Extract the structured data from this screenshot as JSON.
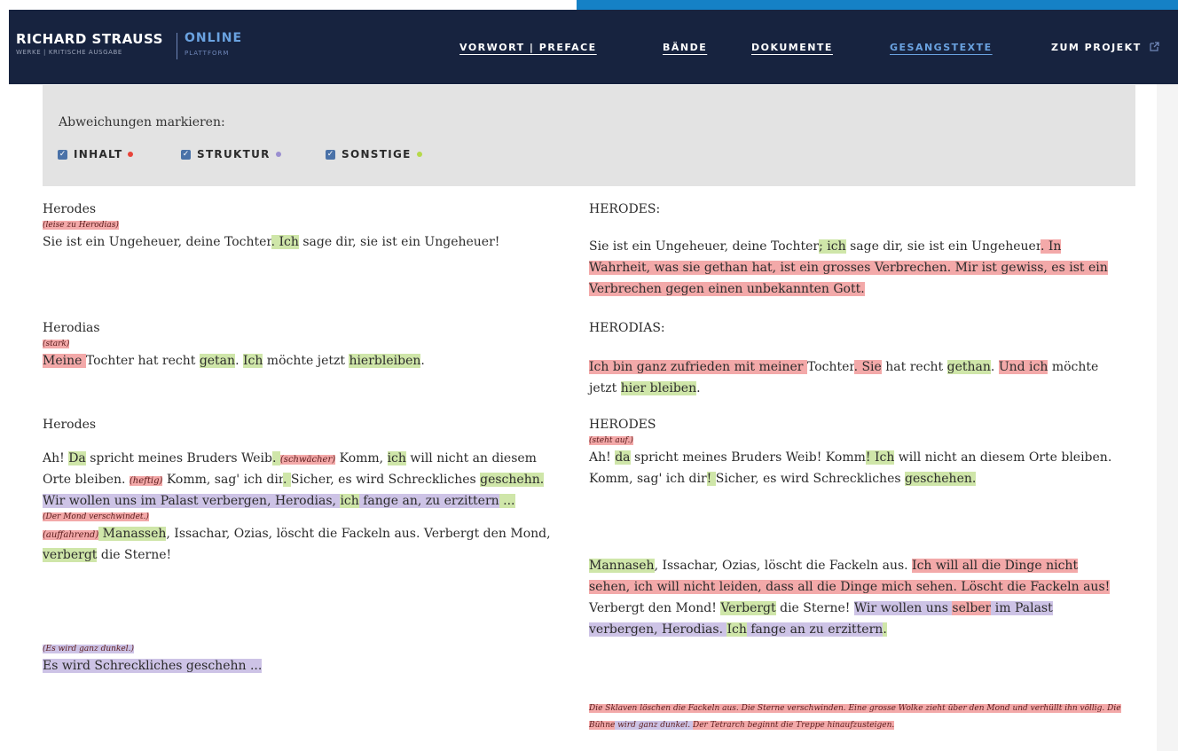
{
  "header": {
    "brand": {
      "name": "RICHARD STRAUSS",
      "sub": "WERKE | KRITISCHE AUSGABE",
      "online": "ONLINE",
      "platform": "PLATTFORM"
    },
    "menu": [
      {
        "label": "VORWORT | PREFACE"
      },
      {
        "label": "BÄNDE"
      },
      {
        "label": "DOKUMENTE"
      },
      {
        "label": "GESANGSTEXTE"
      },
      {
        "label": "ZUM PROJEKT"
      }
    ],
    "external_icon": "external-link-icon"
  },
  "filter": {
    "title": "Abweichungen markieren:",
    "options": [
      {
        "label": "INHALT",
        "checked": true,
        "color": "#e8443a"
      },
      {
        "label": "STRUKTUR",
        "checked": true,
        "color": "#9b8fd0"
      },
      {
        "label": "SONSTIGE",
        "checked": true,
        "color": "#b6d94a"
      }
    ]
  },
  "colors": {
    "content": "#f3a9a9",
    "structure": "#cdc3e6",
    "other": "#cfe6a9",
    "nav": "#17233f",
    "accent": "#1581c6"
  },
  "left": {
    "b1": {
      "speaker": "Herodes",
      "dir": "(leise zu Herodias)",
      "t1": "Sie ist ein Ungeheuer, deine Tochter",
      "t2": ". ",
      "t3": "Ich",
      "t4": " sage dir, sie ist ein Ungeheuer!"
    },
    "b2": {
      "speaker": "Herodias",
      "dir": "(stark)",
      "t1": "Meine ",
      "t2": "Tochter hat recht ",
      "t3": "getan",
      "t4": ". ",
      "t5": "Ich",
      "t6": " möchte jetzt ",
      "t7": "hierbleiben",
      "t8": "."
    },
    "b3": {
      "speaker": "Herodes",
      "t1": "Ah! ",
      "t2": "Da",
      "t3": " spricht meines Bruders Weib",
      "t4": ". ",
      "t5": "(schwächer)",
      "t6": " Komm, ",
      "t7": "ich",
      "t8": " will nicht an diesem Orte bleiben. ",
      "t9": "(heftig)",
      "t10": " Komm, sag' ich dir",
      "t11": ". ",
      "t12": "Sicher, es wird Schreckliches ",
      "t13": "geschehn",
      "t14": ". ",
      "t15": "Wir wollen uns im Palast verbergen, Herodias, ",
      "t16": "ich",
      "t17": " fange an, zu erzittern",
      "t18": " ...",
      "dir1": "(Der Mond verschwindet.)",
      "t19": "(auffahrend)",
      "t20": " Manasseh",
      "t21": ", Issachar, Ozias, löscht die Fackeln aus. Verbergt den Mond, ",
      "t22": "verbergt",
      "t23": " die Sterne!"
    },
    "b4": {
      "dir": "(Es wird ganz dunkel.)",
      "t1": "Es wird Schreckliches geschehn ..."
    }
  },
  "right": {
    "b1": {
      "speaker": "HERODES:",
      "t1": "Sie ist ein Ungeheuer, deine Tochter",
      "t2": "; ",
      "t3": "ich",
      "t4": " sage dir, sie ist ein Ungeheuer",
      "t5": ". In Wahrheit, was sie gethan hat, ist ein grosses Verbrechen. Mir ist gewiss, es ist ein Verbrechen gegen einen unbekannten Gott."
    },
    "b2": {
      "speaker": "HERODIAS:",
      "t1": "Ich bin ganz zufrieden mit meiner ",
      "t2": "Tochter",
      "t3": ". Sie",
      "t4": " hat recht ",
      "t5": "gethan",
      "t6": ". ",
      "t7": "Und ich",
      "t8": " möchte jetzt ",
      "t9": "hier bleiben",
      "t10": "."
    },
    "b3": {
      "speaker": "HERODES",
      "dir": "(steht auf.)",
      "t1": "Ah! ",
      "t2": "da",
      "t3": " spricht meines Bruders Weib! Komm",
      "t4": "! ",
      "t5": "Ich",
      "t6": " will nicht an diesem Orte bleiben. Komm, sag' ich dir",
      "t7": "! ",
      "t8": "Sicher, es wird Schreckliches ",
      "t9": "geschehen",
      "t10": "."
    },
    "b4": {
      "t1": "Mannaseh",
      "t2": ", Issachar, Ozias, löscht die Fackeln aus. ",
      "t3": "Ich will all die Dinge nicht sehen, ich will nicht leiden, dass all die Dinge mich sehen. Löscht die Fackeln aus!",
      "t4": " Verbergt den Mond! ",
      "t5": "Verbergt",
      "t6": " die Sterne! ",
      "t7": "Wir wollen uns ",
      "t8": "selber",
      "t9": " im Palast verbergen, Herodias. ",
      "t10": "Ich",
      "t11": " fange an zu erzittern",
      "t12": "."
    },
    "b5": {
      "t1": "Die Sklaven löschen die Fackeln aus. Die Sterne verschwinden. Eine grosse Wolke zieht über den Mond und verhüllt ihn völlig. Die Bühne",
      "t2": " wird ganz dunkel. ",
      "t3": "Der Tetrarch beginnt die Treppe hinaufzusteigen."
    }
  }
}
